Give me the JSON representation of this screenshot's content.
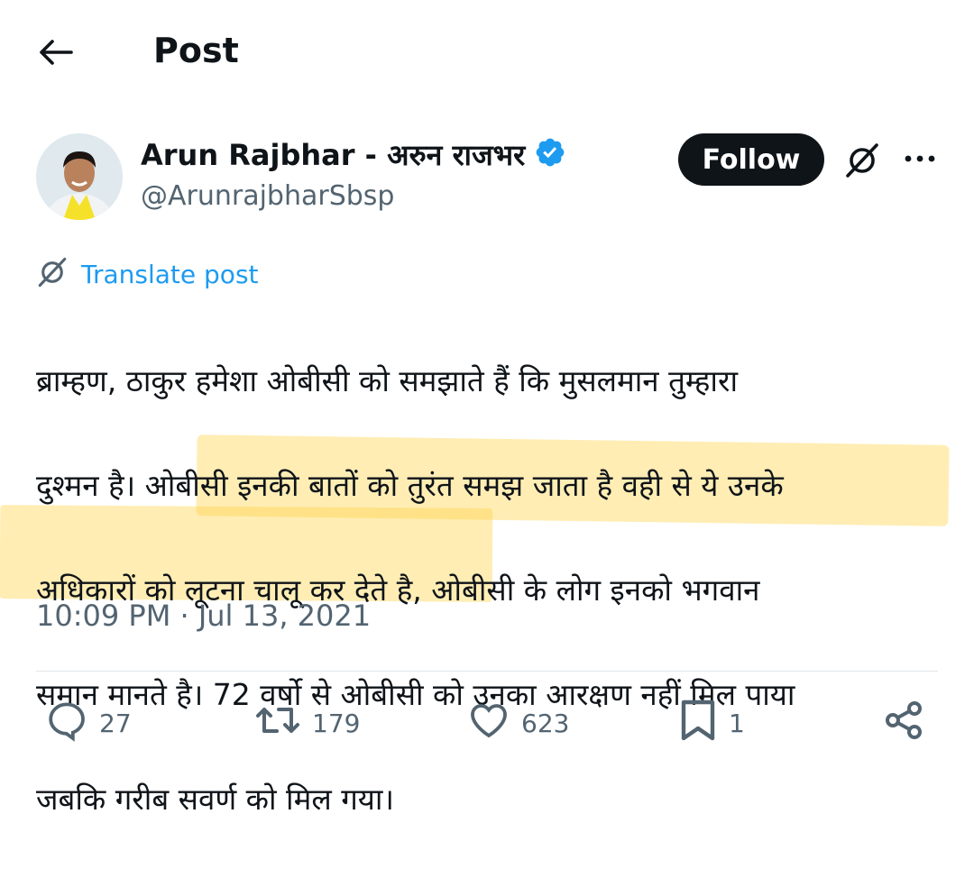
{
  "header": {
    "title": "Post",
    "back_icon": "arrow-left-icon"
  },
  "author": {
    "display_name": "Arun Rajbhar - अरुन राजभर",
    "handle": "@ArunrajbharSbsp",
    "verified": true,
    "verified_color": "#1d9bf0"
  },
  "actions_top": {
    "follow_label": "Follow",
    "grok_icon": "grok-icon",
    "more_icon": "more-dots-icon"
  },
  "translate": {
    "label": "Translate post",
    "color": "#1d9bf0"
  },
  "post": {
    "line1": "ब्राम्हण, ठाकुर हमेशा ओबीसी को समझाते हैं कि मुसलमान तुम्हारा",
    "line2": "दुश्मन है। ओबीसी इनकी बातों को तुरंत समझ जाता है वही से ये उनके",
    "line3": "अधिकारों को लूटना चालू कर देते है, ओबीसी के लोग इनको भगवान",
    "line4": "समान मानते है। 72 वर्षो से ओबीसी को उनका आरक्षण नहीं मिल पाया",
    "line5": "जबकि गरीब सवर्ण को मिल गया।",
    "highlight_color": "#ffd54d"
  },
  "timestamp": "10:09 PM · Jul 13, 2021",
  "stats": {
    "replies": "27",
    "reposts": "179",
    "likes": "623",
    "bookmarks": "1"
  },
  "icons": [
    "reply-icon",
    "repost-icon",
    "like-icon",
    "bookmark-icon",
    "share-icon"
  ]
}
